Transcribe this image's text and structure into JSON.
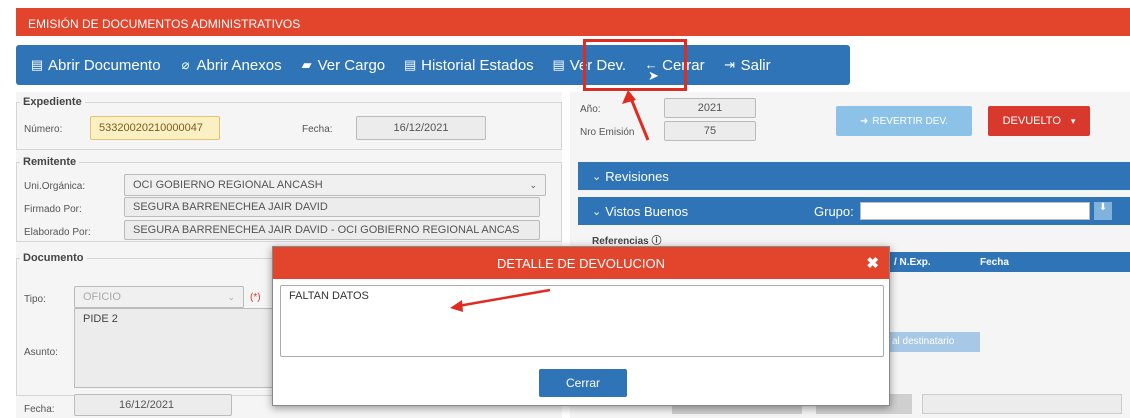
{
  "window": {
    "title": "EMISIÓN DE DOCUMENTOS ADMINISTRATIVOS"
  },
  "toolbar": {
    "items": [
      {
        "label": "Abrir Documento",
        "icon": "list-icon"
      },
      {
        "label": "Abrir Anexos",
        "icon": "paperclip-icon"
      },
      {
        "label": "Ver Cargo",
        "icon": "folder-open-icon"
      },
      {
        "label": "Historial Estados",
        "icon": "list-icon"
      },
      {
        "label": "Ver Dev.",
        "icon": "list-icon"
      },
      {
        "label": "Cerrar",
        "icon": "arrow-left-icon"
      },
      {
        "label": "Salir",
        "icon": "sign-out-icon"
      }
    ]
  },
  "expediente": {
    "legend": "Expediente",
    "numero_label": "Número:",
    "numero_value": "53320020210000047",
    "fecha_label": "Fecha:",
    "fecha_value": "16/12/2021"
  },
  "emision": {
    "anio_label": "Año:",
    "anio_value": "2021",
    "nro_label": "Nro Emisión",
    "nro_value": "75"
  },
  "actions": {
    "revertir": "REVERTIR DEV.",
    "devuelto": "DEVUELTO"
  },
  "remitente": {
    "legend": "Remitente",
    "uni_label": "Uni.Orgánica:",
    "uni_value": "OCI GOBIERNO REGIONAL ANCASH",
    "firmado_label": "Firmado Por:",
    "firmado_value": "SEGURA BARRENECHEA JAIR DAVID",
    "elaborado_label": "Elaborado Por:",
    "elaborado_value": "SEGURA BARRENECHEA JAIR DAVID - OCI GOBIERNO REGIONAL ANCAS"
  },
  "panels": {
    "revisiones": "Revisiones",
    "vistos": "Vistos Buenos",
    "grupo_label": "Grupo:",
    "referencias": "Referencias",
    "col_nexp": "/ N.Exp.",
    "col_fecha": "Fecha",
    "destinatario_btn": "al destinatario"
  },
  "documento": {
    "legend": "Documento",
    "tipo_label": "Tipo:",
    "tipo_value": "OFICIO",
    "required": "(*)",
    "asunto_label": "Asunto:",
    "asunto_value": "PIDE 2",
    "fecha_label": "Fecha:",
    "fecha_value": "16/12/2021"
  },
  "modal": {
    "title": "DETALLE DE DEVOLUCION",
    "text": "FALTAN DATOS",
    "close_button": "Cerrar"
  },
  "annotation_color": "#e02b20"
}
